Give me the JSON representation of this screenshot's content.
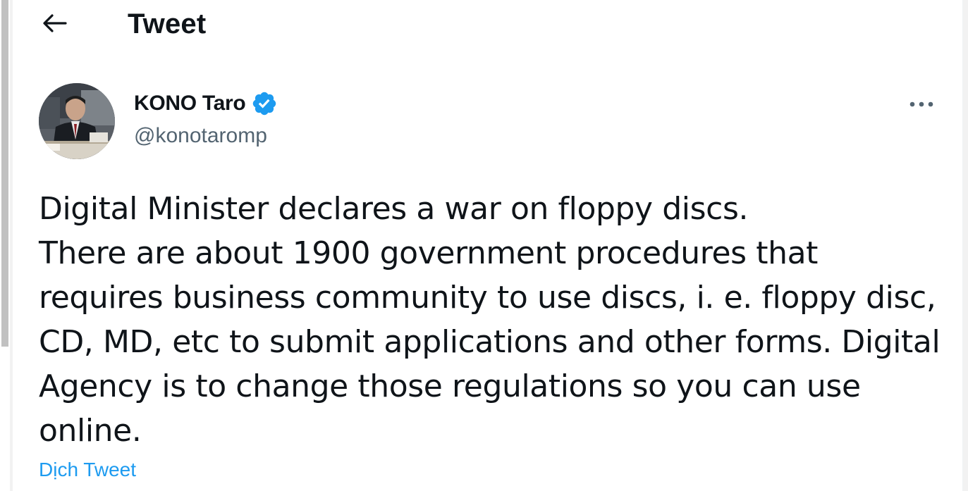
{
  "header": {
    "title": "Tweet",
    "back_icon": "arrow-left-icon"
  },
  "author": {
    "name": "KONO Taro",
    "handle": "@konotaromp",
    "verified": true,
    "verified_color": "#1d9bf0"
  },
  "tweet": {
    "text": "Digital Minister declares a war on floppy discs.\nThere are about 1900 government procedures that requires business community to use discs, i. e. floppy disc, CD, MD, etc to submit applications and other forms. Digital Agency is to change those regulations so you can use online.",
    "translate_label": "Dịch Tweet"
  },
  "colors": {
    "accent": "#1d9bf0",
    "text_primary": "#0f1419",
    "text_secondary": "#536471"
  }
}
